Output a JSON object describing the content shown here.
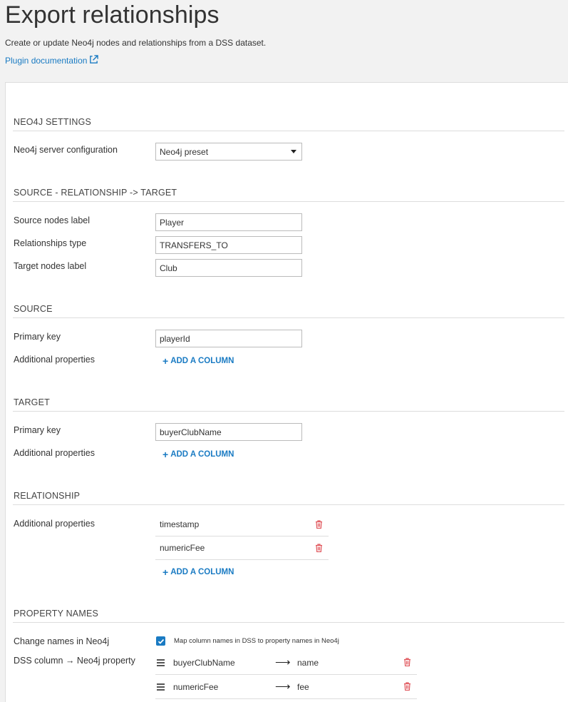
{
  "header": {
    "title": "Export relationships",
    "description": "Create or update Neo4j nodes and relationships from a DSS dataset.",
    "doc_link": "Plugin documentation"
  },
  "sections": {
    "neo4j_settings": {
      "title": "NEO4J SETTINGS",
      "server_config_label": "Neo4j server configuration",
      "server_config_value": "Neo4j preset"
    },
    "source_rel_target": {
      "title": "SOURCE - RELATIONSHIP -> TARGET",
      "source_label_label": "Source nodes label",
      "source_label_value": "Player",
      "rel_type_label": "Relationships type",
      "rel_type_value": "TRANSFERS_TO",
      "target_label_label": "Target nodes label",
      "target_label_value": "Club"
    },
    "source": {
      "title": "SOURCE",
      "pk_label": "Primary key",
      "pk_value": "playerId",
      "props_label": "Additional properties",
      "add_column": "ADD A COLUMN"
    },
    "target": {
      "title": "TARGET",
      "pk_label": "Primary key",
      "pk_value": "buyerClubName",
      "props_label": "Additional properties",
      "add_column": "ADD A COLUMN"
    },
    "relationship": {
      "title": "RELATIONSHIP",
      "props_label": "Additional properties",
      "props": [
        "timestamp",
        "numericFee"
      ],
      "add_column": "ADD A COLUMN"
    },
    "property_names": {
      "title": "PROPERTY NAMES",
      "change_label": "Change names in Neo4j",
      "checkbox_label": "Map column names in DSS to property names in Neo4j",
      "checkbox_checked": true,
      "mapping_label": "DSS column → Neo4j property",
      "arrow": "⟶",
      "mappings": [
        {
          "column": "buyerClubName",
          "property": "name"
        },
        {
          "column": "numericFee",
          "property": "fee"
        }
      ]
    }
  },
  "colors": {
    "accent": "#1a7bc3",
    "danger": "#e0545a"
  }
}
